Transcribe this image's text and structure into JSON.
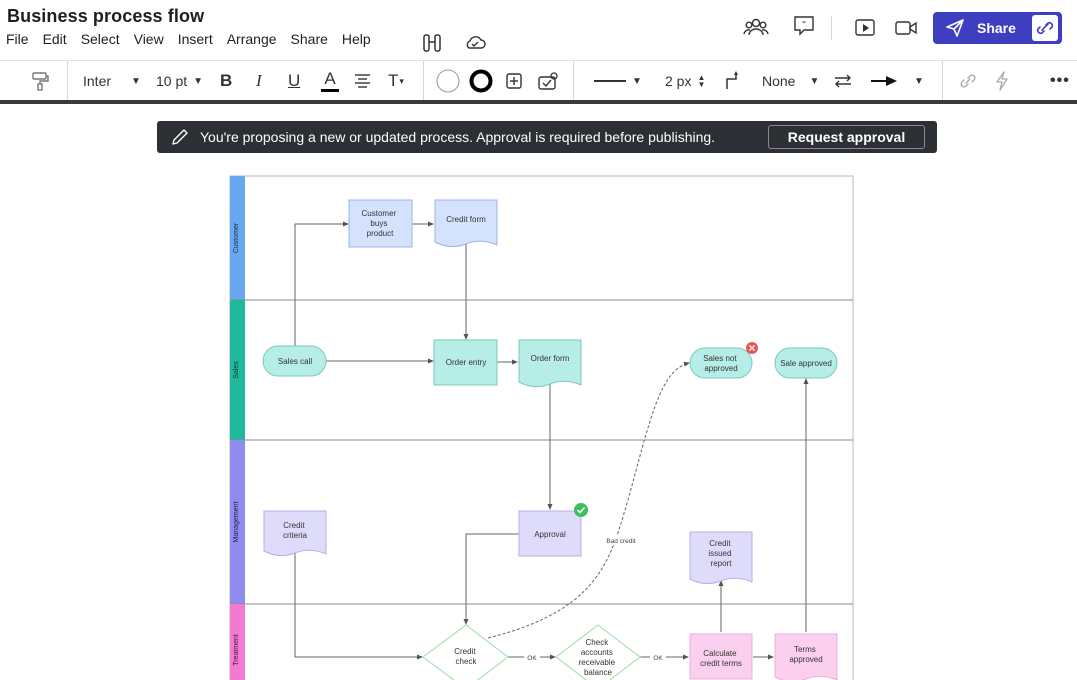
{
  "app": {
    "title": "Business process flow"
  },
  "menu": [
    "File",
    "Edit",
    "Select",
    "View",
    "Insert",
    "Arrange",
    "Share",
    "Help"
  ],
  "header": {
    "share_label": "Share"
  },
  "toolbar": {
    "font": "Inter",
    "font_size": "10 pt",
    "bold": "B",
    "italic": "I",
    "underline": "U",
    "text_color": "A",
    "text_options": "T",
    "line_width": "2 px",
    "start_arrow": "None"
  },
  "banner": {
    "message": "You're proposing a new or updated process. Approval is required before publishing.",
    "button": "Request approval"
  },
  "diagram": {
    "lanes": [
      "Customer",
      "Sales",
      "Management",
      "Treatment"
    ],
    "shapes": {
      "customer_buys": [
        "Customer",
        "buys",
        "product"
      ],
      "credit_form": [
        "Credit form"
      ],
      "sales_call": [
        "Sales call"
      ],
      "order_entry": [
        "Order entry"
      ],
      "order_form": [
        "Order form"
      ],
      "sales_not_approved": [
        "Sales not",
        "approved"
      ],
      "sale_approved": [
        "Sale approved"
      ],
      "credit_criteria": [
        "Credit",
        "criteria"
      ],
      "approval": [
        "Approval"
      ],
      "credit_issued_report": [
        "Credit",
        "issued",
        "report"
      ],
      "credit_check": [
        "Credit",
        "check"
      ],
      "check_accounts": [
        "Check",
        "accounts",
        "receivable",
        "balance"
      ],
      "calculate_credit_terms": [
        "Calculate",
        "credit terms"
      ],
      "terms_approved": [
        "Terms",
        "approved"
      ]
    },
    "edge_labels": {
      "bad_credit": "Bad credit",
      "ok1": "OK",
      "ok2": "OK"
    }
  },
  "colors": {
    "accent": "#3d3fc0",
    "lane_customer": "#67a8f0",
    "lane_sales": "#1fb89c",
    "lane_management": "#8f8cf0",
    "lane_treatment": "#f27ad0"
  }
}
